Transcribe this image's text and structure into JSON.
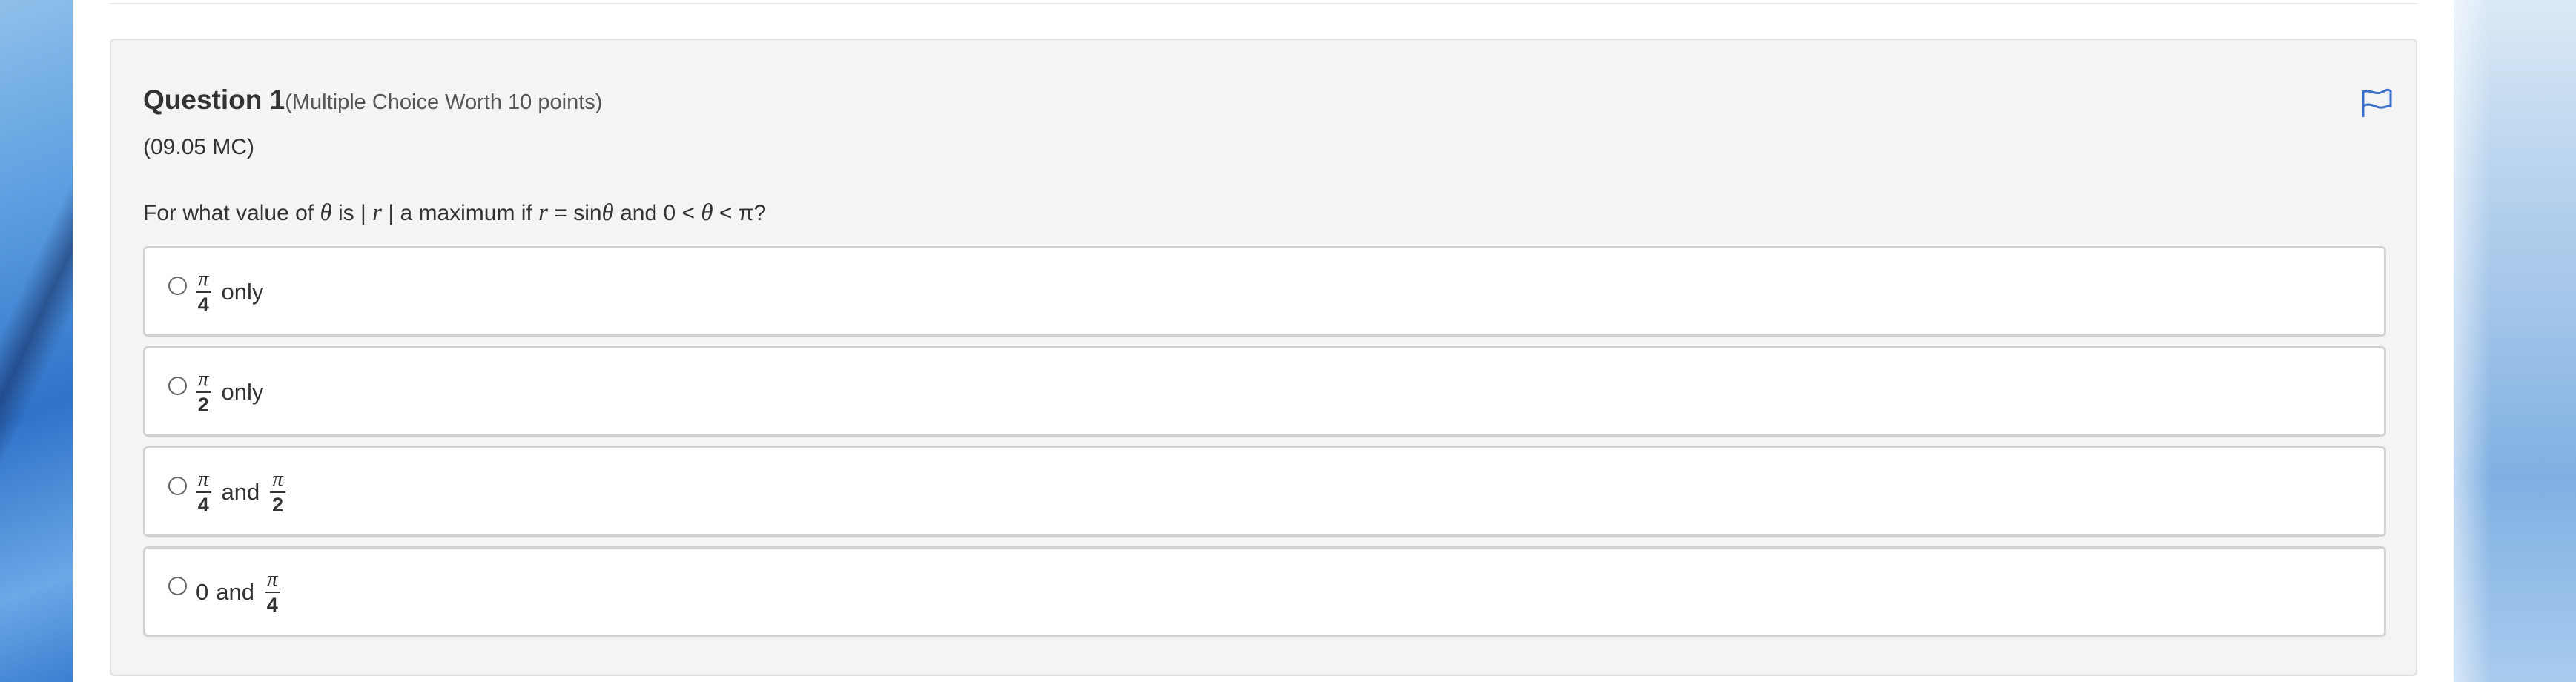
{
  "question": {
    "title": "Question 1",
    "worth": "(Multiple Choice Worth 10 points)",
    "code": "(09.05 MC)",
    "stem": {
      "t1": "For what value of ",
      "theta": "θ",
      "t2": " is | ",
      "r": "r",
      "t3": " | a maximum if ",
      "r2": "r",
      "t4": " = sin",
      "theta2": "θ",
      "t5": " and 0 < ",
      "theta3": "θ",
      "t6": " < π?"
    },
    "flag_icon": "flag-icon"
  },
  "options": [
    {
      "frac1": {
        "num": "π",
        "den": "4"
      },
      "text": "only"
    },
    {
      "frac1": {
        "num": "π",
        "den": "2"
      },
      "text": "only"
    },
    {
      "frac1": {
        "num": "π",
        "den": "4"
      },
      "text": "and",
      "frac2": {
        "num": "π",
        "den": "2"
      }
    },
    {
      "lead": "0",
      "text": "and",
      "frac2": {
        "num": "π",
        "den": "4"
      }
    }
  ],
  "colors": {
    "flag": "#3a6fc9",
    "card_bg": "#f4f4f4",
    "option_border": "#d2d2d2"
  }
}
